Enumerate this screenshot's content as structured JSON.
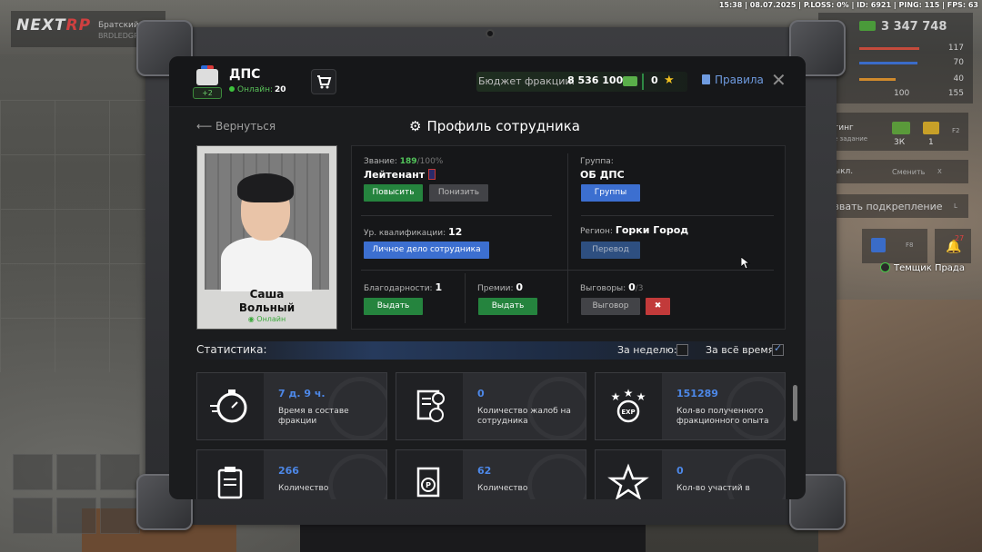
{
  "perf": "15:38 | 08.07.2025 | P.LOSS: 0% | ID: 6921 | PING: 115 | FPS: 63",
  "hud": {
    "logo_a": "NEXT",
    "logo_b": "RP",
    "server": "Братский",
    "server_sub": "BRDLEDGR",
    "money": "3 347 748",
    "stats": [
      {
        "value": "117",
        "color": "#c54b3c"
      },
      {
        "value": "70",
        "color": "#3a6cc8"
      },
      {
        "value": "40",
        "color": "#d08a2c"
      },
      {
        "value": "100",
        "extra": "155",
        "color": "#999999"
      }
    ],
    "rating_label": "тинг",
    "task_label": "е задание",
    "count_3k": "3К",
    "count_1": "1",
    "key_f2": "F2",
    "change_label": "Сменить",
    "key_x": "X",
    "key_l": "L",
    "exit_label": "ыкл.",
    "reinforce_label": "звать подкрепление",
    "key_f8": "F8",
    "notif_count": "27",
    "npc_name": "Темщик Прада"
  },
  "header": {
    "faction_name": "ДПС",
    "faction_badge": "+2",
    "online_label": "Онлайн:",
    "online_count": "20",
    "budget_label": "Бюджет фракции:",
    "budget_amount": "8 536 100",
    "stars": "0",
    "rules_label": "Правила"
  },
  "page": {
    "back_label": "Вернуться",
    "title": "Профиль сотрудника"
  },
  "employee": {
    "first_name": "Саша",
    "last_name": "Вольный",
    "status": "Онлайн",
    "rank_label": "Звание:",
    "rank_points": "189",
    "rank_max": "/100%",
    "rank_name": "Лейтенант",
    "promote_label": "Повысить",
    "demote_label": "Понизить",
    "group_label": "Группа:",
    "group_name": "ОБ ДПС",
    "groups_button": "Группы",
    "qual_label": "Ур. квалификации:",
    "qual_value": "12",
    "file_button": "Личное дело сотрудника",
    "region_label": "Регион:",
    "region_name": "Горки Город",
    "transfer_button": "Перевод",
    "thanks_label": "Благодарности:",
    "thanks_value": "1",
    "thanks_button": "Выдать",
    "bonus_label": "Премии:",
    "bonus_value": "0",
    "bonus_button": "Выдать",
    "warn_label": "Выговоры:",
    "warn_value": "0",
    "warn_max": "/3",
    "warn_button": "Выговор"
  },
  "stats": {
    "title": "Статистика:",
    "week_label": "За неделю:",
    "all_label": "За всё время:",
    "week_checked": false,
    "all_checked": true,
    "cards": [
      {
        "value": "7 д. 9 ч.",
        "desc": "Время в составе фракции",
        "icon": "stopwatch-icon"
      },
      {
        "value": "0",
        "desc": "Количество жалоб на сотрудника",
        "icon": "complaint-document-icon"
      },
      {
        "value": "151289",
        "desc": "Кол-во полученного фракционного опыта",
        "icon": "exp-stars-icon"
      },
      {
        "value": "266",
        "desc": "Количество",
        "icon": "clipboard-icon"
      },
      {
        "value": "62",
        "desc": "Количество",
        "icon": "coin-document-icon"
      },
      {
        "value": "0",
        "desc": "Кол-во участий в",
        "icon": "star-icon"
      }
    ]
  }
}
